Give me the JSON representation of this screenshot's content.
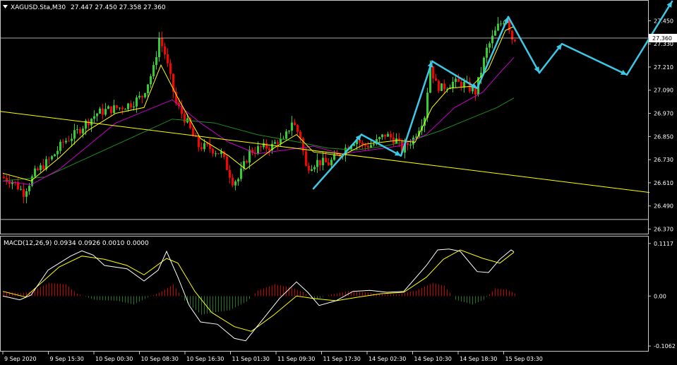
{
  "header": {
    "menu_icon": "triangle-down-icon",
    "symbol": "XAGUSD.Sta,M30",
    "ohlc": "27.447 27.450 27.358 27.360"
  },
  "macd_header": {
    "label": "MACD(12,26,9) 0.0934 0.0926 0.0010 0.0000"
  },
  "colors": {
    "background": "#000000",
    "frame": "#c8c8c8",
    "axis_text": "#ffffff",
    "bull": "#32cd32",
    "bear": "#ff0000",
    "ma_fast": "#ffff00",
    "ma_mid": "#c800c8",
    "ma_slow": "#1e8c1e",
    "trend_line": "#ffff00",
    "forecast": "#3cc8e6",
    "macd_line": "#ffffff",
    "signal_line": "#ffff00",
    "hist_up": "#c80000",
    "hist_down": "#1e781e",
    "hline": "#c0c0c0"
  },
  "chart_data": [
    {
      "type": "candlestick",
      "symbol": "XAGUSD.Sta",
      "timeframe": "M30",
      "ylim": [
        26.35,
        27.55
      ],
      "y_ticks": [
        "27.450",
        "27.330",
        "27.210",
        "27.090",
        "26.970",
        "26.850",
        "26.730",
        "26.610",
        "26.490",
        "26.370"
      ],
      "current_price": "27.360",
      "time_labels": [
        "9 Sep 2020",
        "9 Sep 15:30",
        "10 Sep 00:30",
        "10 Sep 08:30",
        "10 Sep 16:30",
        "11 Sep 01:30",
        "11 Sep 09:30",
        "11 Sep 17:30",
        "14 Sep 02:30",
        "14 Sep 10:30",
        "14 Sep 18:30",
        "15 Sep 03:30"
      ],
      "price_path": [
        [
          0,
          26.64
        ],
        [
          4,
          26.62
        ],
        [
          8,
          26.56
        ],
        [
          12,
          26.66
        ],
        [
          18,
          26.74
        ],
        [
          22,
          26.82
        ],
        [
          26,
          26.86
        ],
        [
          30,
          26.92
        ],
        [
          34,
          26.97
        ],
        [
          38,
          26.99
        ],
        [
          42,
          27.0
        ],
        [
          46,
          27.02
        ],
        [
          50,
          27.06
        ],
        [
          54,
          27.2
        ],
        [
          56,
          27.36
        ],
        [
          58,
          27.28
        ],
        [
          62,
          27.02
        ],
        [
          66,
          26.92
        ],
        [
          68,
          26.85
        ],
        [
          70,
          26.8
        ],
        [
          74,
          26.79
        ],
        [
          78,
          26.76
        ],
        [
          80,
          26.69
        ],
        [
          82,
          26.62
        ],
        [
          84,
          26.63
        ],
        [
          86,
          26.7
        ],
        [
          88,
          26.77
        ],
        [
          92,
          26.79
        ],
        [
          96,
          26.8
        ],
        [
          98,
          26.83
        ],
        [
          100,
          26.82
        ],
        [
          103,
          26.93
        ],
        [
          106,
          26.85
        ],
        [
          108,
          26.69
        ],
        [
          112,
          26.72
        ],
        [
          116,
          26.71
        ],
        [
          120,
          26.76
        ],
        [
          124,
          26.82
        ],
        [
          126,
          26.84
        ],
        [
          128,
          26.8
        ],
        [
          132,
          26.81
        ],
        [
          136,
          26.86
        ],
        [
          140,
          26.83
        ],
        [
          142,
          26.78
        ],
        [
          146,
          26.84
        ],
        [
          150,
          26.96
        ],
        [
          152,
          27.22
        ],
        [
          154,
          27.12
        ],
        [
          156,
          27.1
        ],
        [
          160,
          27.13
        ],
        [
          164,
          27.12
        ],
        [
          168,
          27.08
        ],
        [
          172,
          27.3
        ],
        [
          176,
          27.42
        ],
        [
          179,
          27.47
        ],
        [
          181,
          27.36
        ]
      ],
      "ma_fast": [
        [
          0,
          26.66
        ],
        [
          10,
          26.62
        ],
        [
          20,
          26.74
        ],
        [
          30,
          26.88
        ],
        [
          40,
          26.97
        ],
        [
          50,
          27.0
        ],
        [
          56,
          27.22
        ],
        [
          62,
          27.05
        ],
        [
          70,
          26.84
        ],
        [
          80,
          26.75
        ],
        [
          86,
          26.68
        ],
        [
          96,
          26.79
        ],
        [
          104,
          26.86
        ],
        [
          110,
          26.77
        ],
        [
          120,
          26.75
        ],
        [
          128,
          26.81
        ],
        [
          140,
          26.83
        ],
        [
          146,
          26.82
        ],
        [
          152,
          27.0
        ],
        [
          158,
          27.1
        ],
        [
          166,
          27.11
        ],
        [
          172,
          27.2
        ],
        [
          178,
          27.4
        ],
        [
          181,
          27.42
        ]
      ],
      "ma_mid": [
        [
          0,
          26.62
        ],
        [
          10,
          26.6
        ],
        [
          20,
          26.68
        ],
        [
          30,
          26.8
        ],
        [
          40,
          26.92
        ],
        [
          50,
          26.98
        ],
        [
          60,
          27.04
        ],
        [
          70,
          26.92
        ],
        [
          80,
          26.82
        ],
        [
          90,
          26.76
        ],
        [
          100,
          26.78
        ],
        [
          110,
          26.8
        ],
        [
          120,
          26.76
        ],
        [
          130,
          26.78
        ],
        [
          140,
          26.8
        ],
        [
          150,
          26.86
        ],
        [
          160,
          27.0
        ],
        [
          170,
          27.08
        ],
        [
          176,
          27.18
        ],
        [
          181,
          27.26
        ]
      ],
      "ma_slow": [
        [
          0,
          26.62
        ],
        [
          15,
          26.64
        ],
        [
          30,
          26.74
        ],
        [
          45,
          26.84
        ],
        [
          60,
          26.94
        ],
        [
          75,
          26.92
        ],
        [
          90,
          26.86
        ],
        [
          105,
          26.82
        ],
        [
          115,
          26.79
        ],
        [
          125,
          26.78
        ],
        [
          135,
          26.8
        ],
        [
          145,
          26.83
        ],
        [
          155,
          26.88
        ],
        [
          165,
          26.94
        ],
        [
          175,
          27.0
        ],
        [
          181,
          27.05
        ]
      ],
      "trend_line": [
        [
          -1,
          26.98
        ],
        [
          229,
          26.56
        ]
      ],
      "horizontal_lines": [
        26.42
      ],
      "forecast_path": [
        [
          110,
          26.58
        ],
        [
          127,
          26.86
        ],
        [
          141,
          26.75
        ],
        [
          152,
          27.24
        ],
        [
          168,
          27.1
        ],
        [
          179,
          27.47
        ],
        [
          190,
          27.18
        ],
        [
          198,
          27.33
        ],
        [
          221,
          27.17
        ],
        [
          237,
          27.55
        ]
      ]
    },
    {
      "type": "macd",
      "label": "MACD(12,26,9)",
      "values": {
        "macd": "0.0934",
        "signal": "0.0926",
        "histogram": "0.0010",
        "extra": "0.0000"
      },
      "ylim": [
        -0.115,
        0.125
      ],
      "y_ticks": [
        "0.1117",
        "0.00",
        "-0.1062"
      ],
      "macd_line": [
        [
          0,
          0.0
        ],
        [
          6,
          -0.008
        ],
        [
          10,
          0.002
        ],
        [
          16,
          0.055
        ],
        [
          24,
          0.085
        ],
        [
          28,
          0.096
        ],
        [
          32,
          0.087
        ],
        [
          36,
          0.065
        ],
        [
          44,
          0.058
        ],
        [
          50,
          0.032
        ],
        [
          55,
          0.055
        ],
        [
          58,
          0.095
        ],
        [
          62,
          0.04
        ],
        [
          66,
          -0.02
        ],
        [
          70,
          -0.055
        ],
        [
          76,
          -0.06
        ],
        [
          82,
          -0.09
        ],
        [
          86,
          -0.095
        ],
        [
          92,
          -0.05
        ],
        [
          98,
          -0.005
        ],
        [
          104,
          0.03
        ],
        [
          108,
          0.008
        ],
        [
          112,
          -0.02
        ],
        [
          118,
          -0.01
        ],
        [
          124,
          0.01
        ],
        [
          130,
          0.012
        ],
        [
          136,
          0.008
        ],
        [
          142,
          0.01
        ],
        [
          150,
          0.065
        ],
        [
          154,
          0.098
        ],
        [
          158,
          0.1
        ],
        [
          162,
          0.095
        ],
        [
          168,
          0.052
        ],
        [
          172,
          0.05
        ],
        [
          176,
          0.078
        ],
        [
          180,
          0.098
        ],
        [
          181,
          0.094
        ]
      ],
      "signal_line": [
        [
          0,
          0.01
        ],
        [
          8,
          -0.002
        ],
        [
          14,
          0.03
        ],
        [
          20,
          0.062
        ],
        [
          28,
          0.085
        ],
        [
          36,
          0.078
        ],
        [
          44,
          0.065
        ],
        [
          50,
          0.045
        ],
        [
          58,
          0.08
        ],
        [
          62,
          0.07
        ],
        [
          68,
          0.01
        ],
        [
          74,
          -0.035
        ],
        [
          82,
          -0.065
        ],
        [
          88,
          -0.075
        ],
        [
          96,
          -0.04
        ],
        [
          104,
          0.0
        ],
        [
          110,
          -0.005
        ],
        [
          118,
          -0.01
        ],
        [
          126,
          -0.002
        ],
        [
          134,
          0.005
        ],
        [
          142,
          0.008
        ],
        [
          150,
          0.04
        ],
        [
          156,
          0.078
        ],
        [
          162,
          0.098
        ],
        [
          170,
          0.08
        ],
        [
          176,
          0.07
        ],
        [
          181,
          0.093
        ]
      ],
      "histogram_envelope": [
        [
          0,
          0.01
        ],
        [
          6,
          0.006
        ],
        [
          10,
          0.01
        ],
        [
          16,
          0.028
        ],
        [
          22,
          0.025
        ],
        [
          26,
          0.005
        ],
        [
          32,
          -0.008
        ],
        [
          40,
          -0.01
        ],
        [
          46,
          -0.018
        ],
        [
          50,
          -0.006
        ],
        [
          56,
          0.01
        ],
        [
          60,
          0.025
        ],
        [
          64,
          -0.01
        ],
        [
          70,
          -0.04
        ],
        [
          74,
          -0.035
        ],
        [
          80,
          -0.03
        ],
        [
          86,
          -0.012
        ],
        [
          90,
          0.012
        ],
        [
          96,
          0.025
        ],
        [
          102,
          0.018
        ],
        [
          106,
          0.008
        ],
        [
          110,
          -0.008
        ],
        [
          116,
          0.004
        ],
        [
          122,
          0.01
        ],
        [
          128,
          0.008
        ],
        [
          134,
          0.004
        ],
        [
          140,
          0.004
        ],
        [
          146,
          0.012
        ],
        [
          152,
          0.028
        ],
        [
          156,
          0.022
        ],
        [
          160,
          -0.008
        ],
        [
          166,
          -0.018
        ],
        [
          170,
          -0.008
        ],
        [
          174,
          0.016
        ],
        [
          178,
          0.014
        ],
        [
          181,
          0.006
        ]
      ]
    }
  ]
}
